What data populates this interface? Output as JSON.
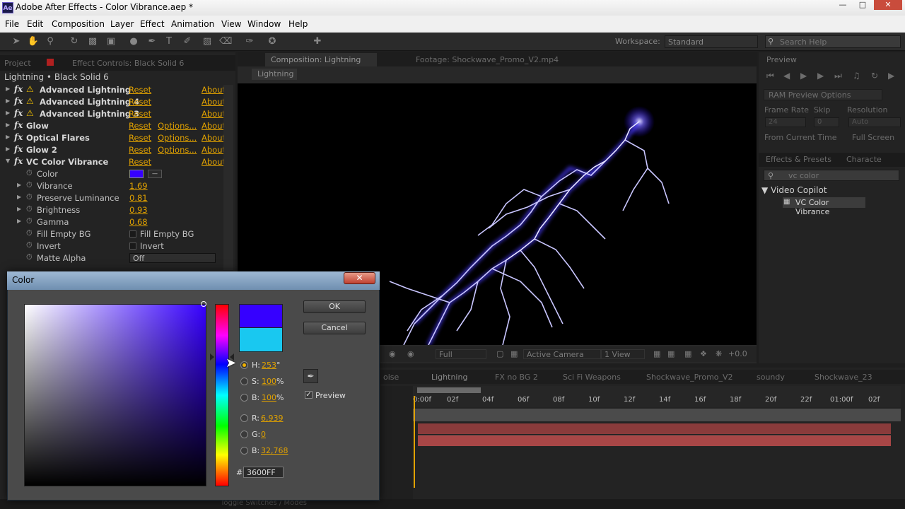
{
  "window": {
    "title": "Adobe After Effects - Color Vibrance.aep *",
    "app_icon": "Ae"
  },
  "menu": [
    "File",
    "Edit",
    "Composition",
    "Layer",
    "Effect",
    "Animation",
    "View",
    "Window",
    "Help"
  ],
  "toolbar": {
    "workspace_label": "Workspace:",
    "workspace_value": "Standard",
    "search_placeholder": "Search Help"
  },
  "left_panel": {
    "tab_project": "Project",
    "tab_effect_controls": "Effect Controls: Black Solid 6",
    "layer_path": "Lightning • Black Solid 6",
    "effects": [
      {
        "name": "Advanced Lightning",
        "warn": true,
        "reset": "Reset",
        "options": "",
        "about": "About"
      },
      {
        "name": "Advanced Lightning 4",
        "warn": true,
        "reset": "Reset",
        "options": "",
        "about": "About"
      },
      {
        "name": "Advanced Lightning 3",
        "warn": true,
        "reset": "Reset",
        "options": "",
        "about": "About"
      },
      {
        "name": "Glow",
        "warn": false,
        "reset": "Reset",
        "options": "Options...",
        "about": "About"
      },
      {
        "name": "Optical Flares",
        "warn": false,
        "reset": "Reset",
        "options": "Options...",
        "about": "About"
      },
      {
        "name": "Glow 2",
        "warn": false,
        "reset": "Reset",
        "options": "Options...",
        "about": "About"
      },
      {
        "name": "VC Color Vibrance",
        "warn": false,
        "reset": "Reset",
        "options": "",
        "about": "About"
      }
    ],
    "params": [
      {
        "name": "Color",
        "value": ""
      },
      {
        "name": "Vibrance",
        "value": "1.69"
      },
      {
        "name": "Preserve Luminance",
        "value": "0.81"
      },
      {
        "name": "Brightness",
        "value": "0.93"
      },
      {
        "name": "Gamma",
        "value": "0.68"
      },
      {
        "name": "Fill Empty BG",
        "value": "Fill Empty BG"
      },
      {
        "name": "Invert",
        "value": "Invert"
      },
      {
        "name": "Matte Alpha",
        "value": "Off"
      }
    ],
    "color_value_hex": "#3600ff"
  },
  "composition": {
    "tab": "Composition: Lightning",
    "footage_tab": "Footage: Shockwave_Promo_V2.mp4",
    "breadcrumb": "Lightning",
    "resolution": "Full",
    "camera": "Active Camera",
    "views": "1 View",
    "exposure": "+0.0"
  },
  "preview_panel": {
    "title": "Preview",
    "ram_options": "RAM Preview Options",
    "frame_rate_label": "Frame Rate",
    "skip_label": "Skip",
    "resolution_label": "Resolution",
    "frame_rate": "24",
    "skip": "0",
    "resolution": "Auto",
    "from_current": "From Current Time",
    "full_screen": "Full Screen"
  },
  "effects_presets": {
    "tab": "Effects & Presets",
    "tab2": "Characte",
    "search": "vc color",
    "group": "Video Copilot",
    "item": "VC Color Vibrance"
  },
  "timeline": {
    "tabs": [
      "oise",
      "Lightning",
      "FX no BG 2",
      "Sci Fi Weapons",
      "Shockwave_Promo_V2",
      "soundy",
      "Shockwave_23"
    ],
    "ticks": [
      "0:00f",
      "02f",
      "04f",
      "06f",
      "08f",
      "10f",
      "12f",
      "14f",
      "16f",
      "18f",
      "20f",
      "22f",
      "01:00f",
      "02f"
    ],
    "bottom_label": "Toggle Switches / Modes"
  },
  "color_dialog": {
    "title": "Color",
    "ok": "OK",
    "cancel": "Cancel",
    "h_label": "H:",
    "h_value": "253",
    "h_unit": "°",
    "s_label": "S:",
    "s_value": "100",
    "s_unit": "%",
    "b_label": "B:",
    "b_value": "100",
    "b_unit": "%",
    "r_label": "R:",
    "r_value": "6,939",
    "g_label": "G:",
    "g_value": "0",
    "b2_label": "B:",
    "b2_value": "32,768",
    "hex_label": "#",
    "hex_value": "3600FF",
    "preview_label": "Preview",
    "new_color": "#3600ff",
    "old_color": "#19c8f0"
  }
}
